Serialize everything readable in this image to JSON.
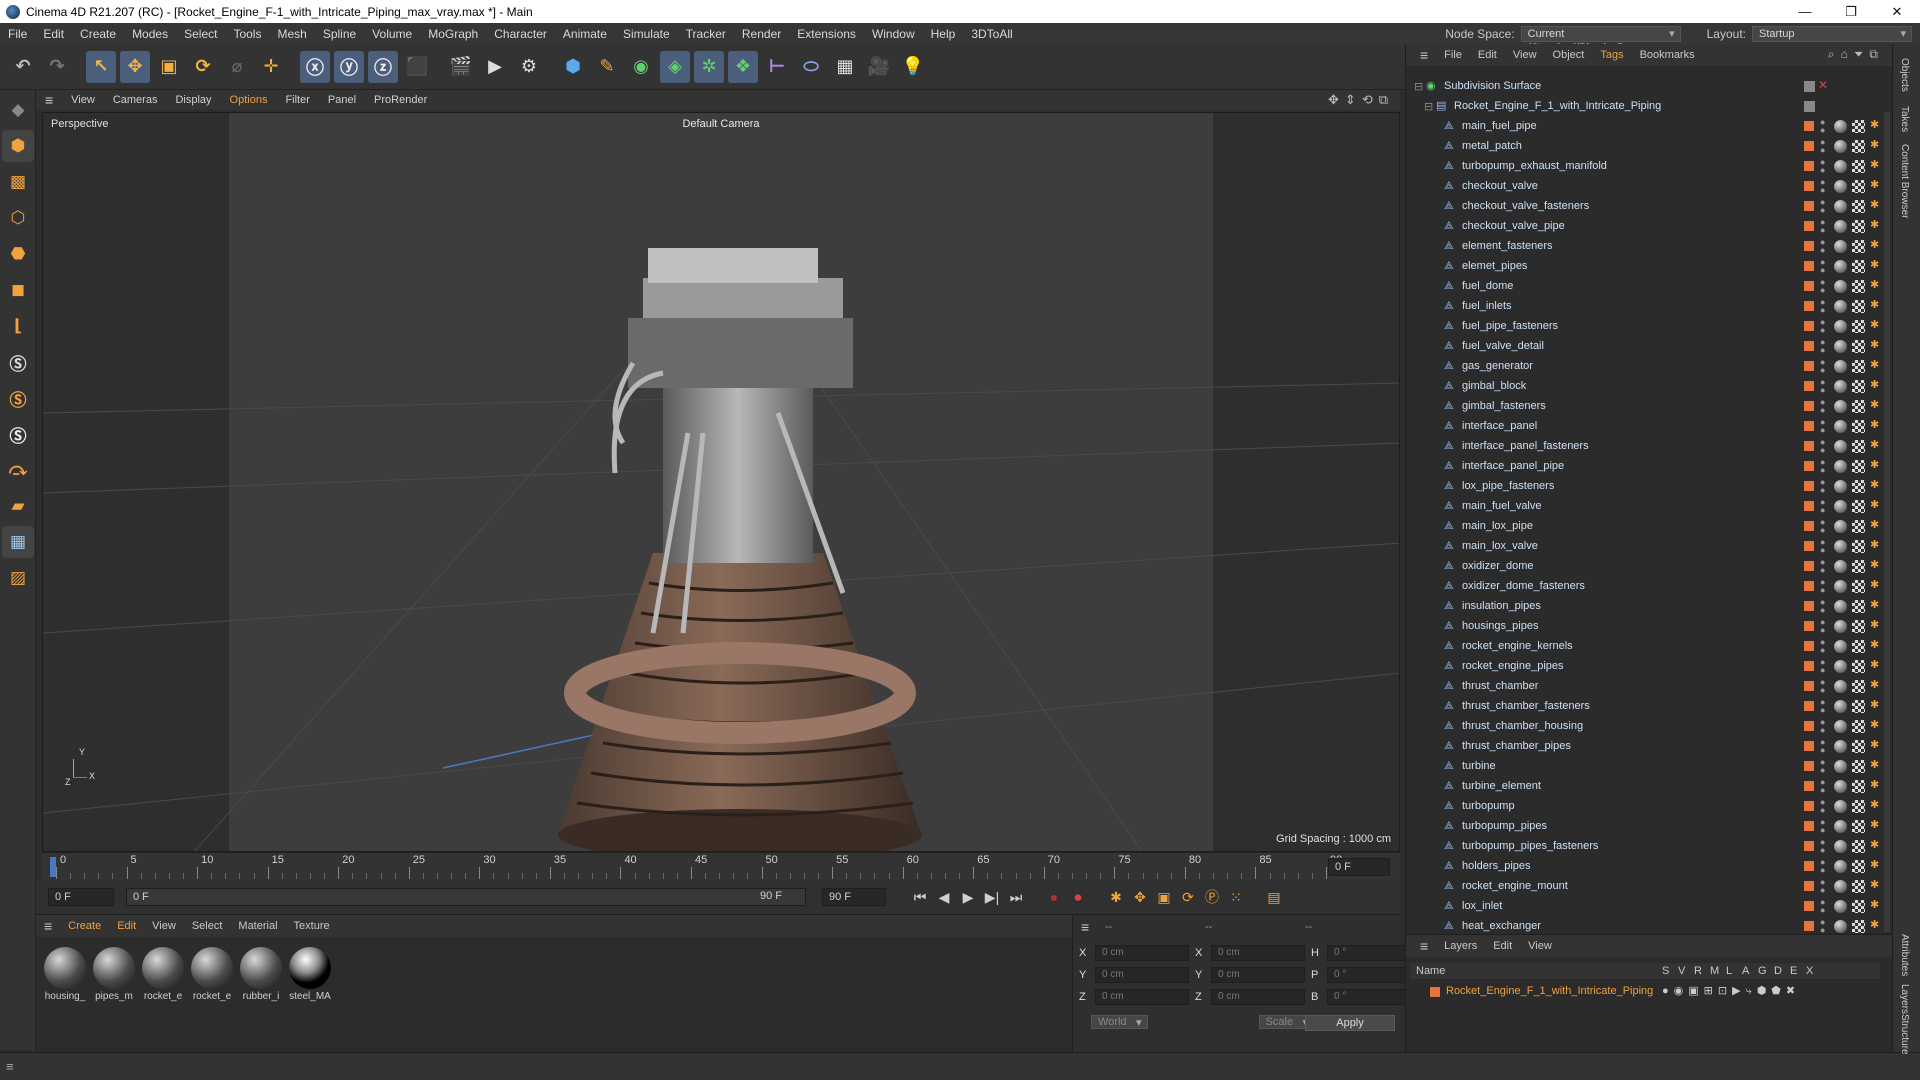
{
  "window": {
    "title": "Cinema 4D R21.207 (RC) - [Rocket_Engine_F-1_with_Intricate_Piping_max_vray.max *] - Main",
    "min": "—",
    "restore": "❐",
    "close": "✕"
  },
  "menu": [
    "File",
    "Edit",
    "Create",
    "Modes",
    "Select",
    "Tools",
    "Mesh",
    "Spline",
    "Volume",
    "MoGraph",
    "Character",
    "Animate",
    "Simulate",
    "Tracker",
    "Render",
    "Extensions",
    "Window",
    "Help",
    "3DToAll"
  ],
  "nodespace": {
    "label": "Node Space:",
    "value": "Current (Standard/Physical)",
    "layout_label": "Layout:",
    "layout_value": "Startup"
  },
  "viewport_menu": [
    "View",
    "Cameras",
    "Display",
    "Options",
    "Filter",
    "Panel",
    "ProRender"
  ],
  "viewport": {
    "name": "Perspective",
    "camera": "Default Camera",
    "grid": "Grid Spacing : 1000 cm",
    "axis_y": "Y",
    "axis_x": "X",
    "axis_z": "Z"
  },
  "timeline": {
    "ticks": [
      "0",
      "5",
      "10",
      "15",
      "20",
      "25",
      "30",
      "35",
      "40",
      "45",
      "50",
      "55",
      "60",
      "65",
      "70",
      "75",
      "80",
      "85",
      "90"
    ],
    "end_field": "0 F"
  },
  "transport": {
    "start": "0 F",
    "current": "0 F",
    "range_end": "90 F",
    "end": "90 F"
  },
  "material_menu": [
    "Create",
    "Edit",
    "View",
    "Select",
    "Material",
    "Texture"
  ],
  "materials": [
    "housing_",
    "pipes_m",
    "rocket_e",
    "rocket_e",
    "rubber_i",
    "steel_MA"
  ],
  "coords": {
    "rows": [
      {
        "a": "X",
        "av": "0 cm",
        "b": "X",
        "bv": "0 cm",
        "c": "H",
        "cv": "0 °"
      },
      {
        "a": "Y",
        "av": "0 cm",
        "b": "Y",
        "bv": "0 cm",
        "c": "P",
        "cv": "0 °"
      },
      {
        "a": "Z",
        "av": "0 cm",
        "b": "Z",
        "bv": "0 cm",
        "c": "B",
        "cv": "0 °"
      }
    ],
    "head1": "--",
    "head2": "--",
    "head3": "--",
    "world": "World",
    "scale": "Scale",
    "apply": "Apply"
  },
  "object_menu": [
    "File",
    "Edit",
    "View",
    "Object",
    "Tags",
    "Bookmarks"
  ],
  "objects": {
    "root": "Subdivision Surface",
    "group": "Rocket_Engine_F_1_with_Intricate_Piping",
    "children": [
      "main_fuel_pipe",
      "metal_patch",
      "turbopump_exhaust_manifold",
      "checkout_valve",
      "checkout_valve_fasteners",
      "checkout_valve_pipe",
      "element_fasteners",
      "elemet_pipes",
      "fuel_dome",
      "fuel_inlets",
      "fuel_pipe_fasteners",
      "fuel_valve_detail",
      "gas_generator",
      "gimbal_block",
      "gimbal_fasteners",
      "interface_panel",
      "interface_panel_fasteners",
      "interface_panel_pipe",
      "lox_pipe_fasteners",
      "main_fuel_valve",
      "main_lox_pipe",
      "main_lox_valve",
      "oxidizer_dome",
      "oxidizer_dome_fasteners",
      "insulation_pipes",
      "housings_pipes",
      "rocket_engine_kernels",
      "rocket_engine_pipes",
      "thrust_chamber",
      "thrust_chamber_fasteners",
      "thrust_chamber_housing",
      "thrust_chamber_pipes",
      "turbine",
      "turbine_element",
      "turbopump",
      "turbopump_pipes",
      "turbopump_pipes_fasteners",
      "holders_pipes",
      "rocket_engine_mount",
      "lox_inlet",
      "heat_exchanger"
    ]
  },
  "layers": {
    "menu": [
      "Layers",
      "Edit",
      "View"
    ],
    "name_col": "Name",
    "cols": [
      "S",
      "V",
      "R",
      "M",
      "L",
      "A",
      "G",
      "D",
      "E",
      "X"
    ],
    "item": "Rocket_Engine_F_1_with_Intricate_Piping"
  },
  "side_tabs": [
    "Objects",
    "Takes",
    "Content Browser",
    "Attributes",
    "Layers",
    "Structure"
  ],
  "colors": {
    "accent": "#f0a23e",
    "layer": "#e8743a",
    "object_text": "#cde0f4"
  }
}
